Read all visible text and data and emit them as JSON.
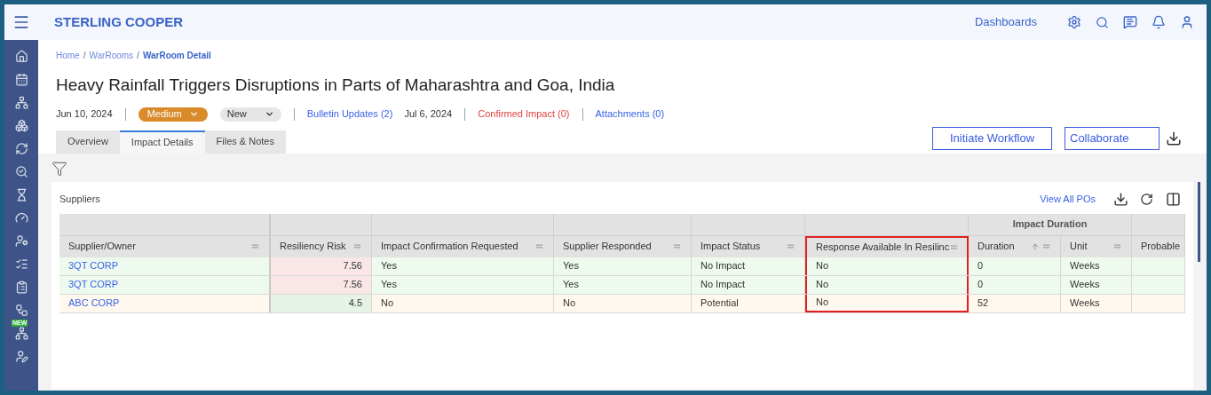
{
  "app": {
    "brand": "STERLING COOPER",
    "nav_link": "Dashboards"
  },
  "sidebar": {
    "badge": "NEW"
  },
  "breadcrumb": [
    {
      "kind": "link",
      "text": "Home"
    },
    {
      "kind": "separator",
      "text": "/"
    },
    {
      "kind": "link",
      "text": "WarRooms"
    },
    {
      "kind": "separator",
      "text": "/"
    },
    {
      "kind": "current",
      "text": "WarRoom Detail"
    }
  ],
  "title": "Heavy Rainfall Triggers Disruptions in Parts of Maharashtra and Goa, India",
  "meta": {
    "date": "Jun 10, 2024",
    "severity": "Medium",
    "status": "New",
    "bulletin": "Bulletin Updates (2)",
    "updated": "Jul 6, 2024",
    "confirmed": "Confirmed Impact (0)",
    "attachments": "Attachments (0)"
  },
  "tabs": [
    {
      "label": "Overview",
      "selected": false
    },
    {
      "label": "Impact Details",
      "selected": true
    },
    {
      "label": "Files & Notes",
      "selected": false
    }
  ],
  "actions": [
    "Initiate Workflow",
    "Collaborate"
  ],
  "suppliers": {
    "title": "Suppliers",
    "view_all": "View All POs",
    "group_header": "Impact Duration",
    "columns": [
      {
        "label": "Supplier/Owner",
        "highlighted": false,
        "sort_ascending": false
      },
      {
        "label": "Resiliency Risk",
        "highlighted": false,
        "sort_ascending": false
      },
      {
        "label": "Impact Confirmation Requested",
        "highlighted": false,
        "sort_ascending": false
      },
      {
        "label": "Supplier Responded",
        "highlighted": false,
        "sort_ascending": false
      },
      {
        "label": "Impact Status",
        "highlighted": false,
        "sort_ascending": false
      },
      {
        "label": "Response Available In Resilinc",
        "highlighted": true,
        "sort_ascending": false
      },
      {
        "label": "Duration",
        "highlighted": false,
        "sort_ascending": true
      },
      {
        "label": "Unit",
        "highlighted": false,
        "sort_ascending": false
      },
      {
        "label": "Probable",
        "highlighted": false,
        "sort_ascending": false
      }
    ],
    "rows": [
      {
        "color": "#eefaee",
        "cells": [
          "3QT CORP",
          {
            "text": "7.56",
            "color": "#fae6e6"
          },
          "Yes",
          "Yes",
          "No Impact",
          "No",
          "0",
          "Weeks"
        ]
      },
      {
        "color": "#eefaee",
        "cells": [
          "3QT CORP",
          {
            "text": "7.56",
            "color": "#fae6e6"
          },
          "Yes",
          "Yes",
          "No Impact",
          "No",
          "0",
          "Weeks"
        ]
      },
      {
        "color": "#fff8ee",
        "cells": [
          "ABC CORP",
          {
            "text": "4.5",
            "color": "#e6f2e6"
          },
          "No",
          "No",
          "Potential",
          "No",
          "52",
          "Weeks"
        ]
      }
    ]
  }
}
